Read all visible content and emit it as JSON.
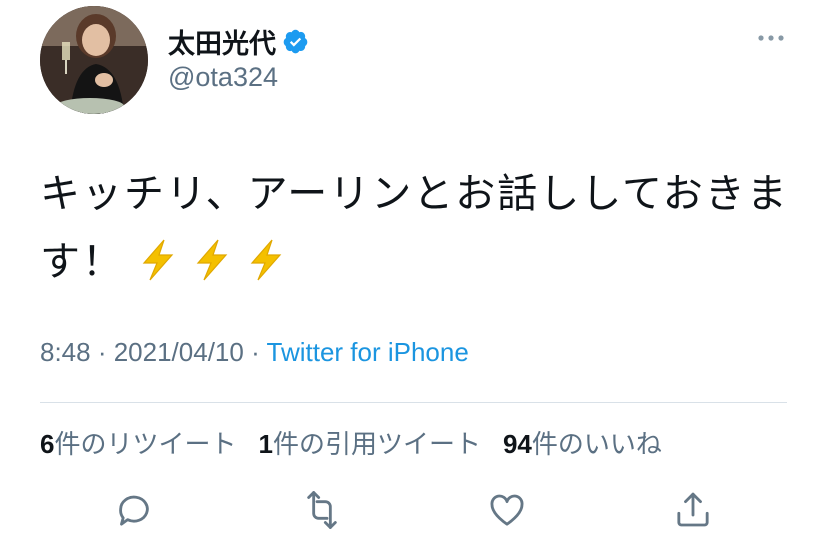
{
  "user": {
    "display_name": "太田光代",
    "handle": "@ota324",
    "verified_icon": "verified-badge-icon"
  },
  "tweet": {
    "text": "キッチリ、アーリンとお話ししておきます！",
    "emoji": [
      "high-voltage",
      "high-voltage",
      "high-voltage"
    ]
  },
  "meta": {
    "time": "8:48",
    "separator": " · ",
    "date": "2021/04/10",
    "source": "Twitter for iPhone"
  },
  "stats": {
    "retweets_count": "6",
    "retweets_label": "件のリツイート",
    "quotes_count": "1",
    "quotes_label": "件の引用ツイート",
    "likes_count": "94",
    "likes_label": "件のいいね"
  },
  "actions": [
    "reply-icon",
    "retweet-icon",
    "like-icon",
    "share-icon"
  ],
  "colors": {
    "text": "#0f1419",
    "secondary": "#5b7083",
    "link": "#1b95e0",
    "divider": "#d9e1e8",
    "icon": "#657786"
  }
}
